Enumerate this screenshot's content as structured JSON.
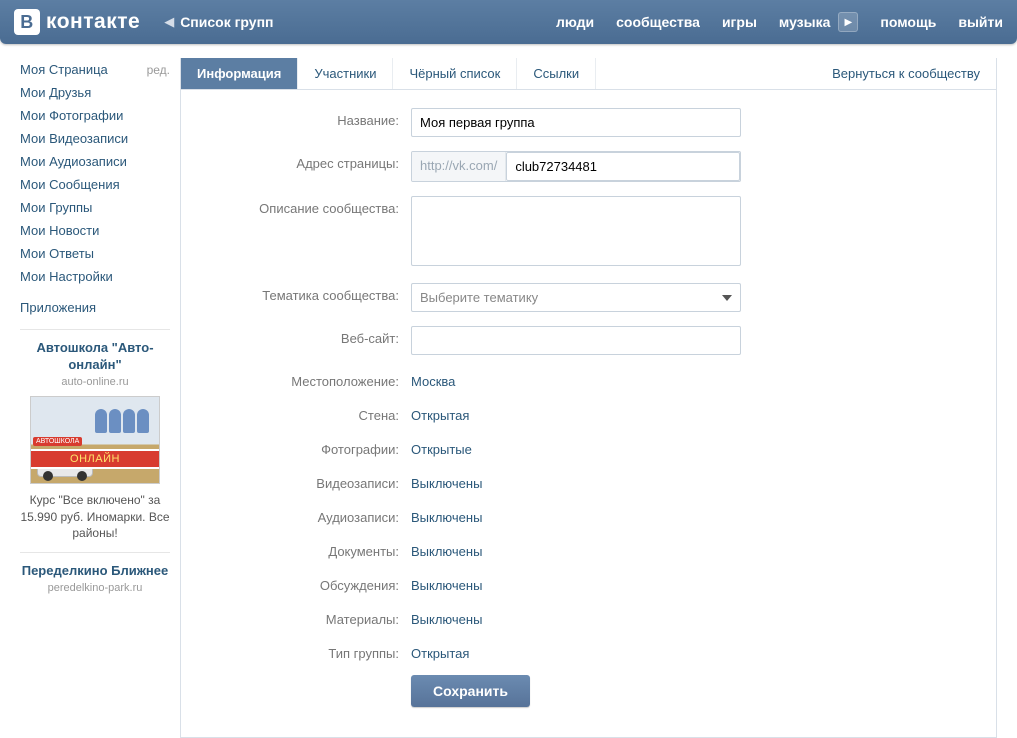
{
  "header": {
    "logo_text": "контакте",
    "logo_badge": "В",
    "back_sub": "Список групп",
    "nav": [
      "люди",
      "сообщества",
      "игры",
      "музыка",
      "помощь",
      "выйти"
    ]
  },
  "sidebar": {
    "edit_label": "ред.",
    "items": [
      "Моя Страница",
      "Мои Друзья",
      "Мои Фотографии",
      "Мои Видеозаписи",
      "Мои Аудиозаписи",
      "Мои Сообщения",
      "Мои Группы",
      "Мои Новости",
      "Мои Ответы",
      "Мои Настройки"
    ],
    "apps": "Приложения",
    "ads": [
      {
        "title": "Автошкола \"Авто-онлайн\"",
        "domain": "auto-online.ru",
        "banner_top": "АВТОШКОЛА",
        "banner": "ОНЛАЙН",
        "text": "Курс \"Все включено\" за 15.990 руб. Иномарки. Все районы!"
      },
      {
        "title": "Переделкино Ближнее",
        "domain": "peredelkino-park.ru"
      }
    ]
  },
  "tabs": {
    "items": [
      "Информация",
      "Участники",
      "Чёрный список",
      "Ссылки"
    ],
    "active": 0,
    "return": "Вернуться к сообществу"
  },
  "form": {
    "labels": {
      "name": "Название:",
      "address": "Адрес страницы:",
      "description": "Описание сообщества:",
      "topic": "Тематика сообщества:",
      "website": "Веб-сайт:",
      "location": "Местоположение:",
      "wall": "Стена:",
      "photos": "Фотографии:",
      "videos": "Видеозаписи:",
      "audio": "Аудиозаписи:",
      "docs": "Документы:",
      "discussions": "Обсуждения:",
      "materials": "Материалы:",
      "group_type": "Тип группы:"
    },
    "values": {
      "name": "Моя первая группа",
      "address_prefix": "http://vk.com/",
      "address": "club72734481",
      "description": "",
      "topic_placeholder": "Выберите тематику",
      "website": "",
      "location": "Москва",
      "wall": "Открытая",
      "photos": "Открытые",
      "videos": "Выключены",
      "audio": "Выключены",
      "docs": "Выключены",
      "discussions": "Выключены",
      "materials": "Выключены",
      "group_type": "Открытая"
    },
    "save": "Сохранить"
  }
}
